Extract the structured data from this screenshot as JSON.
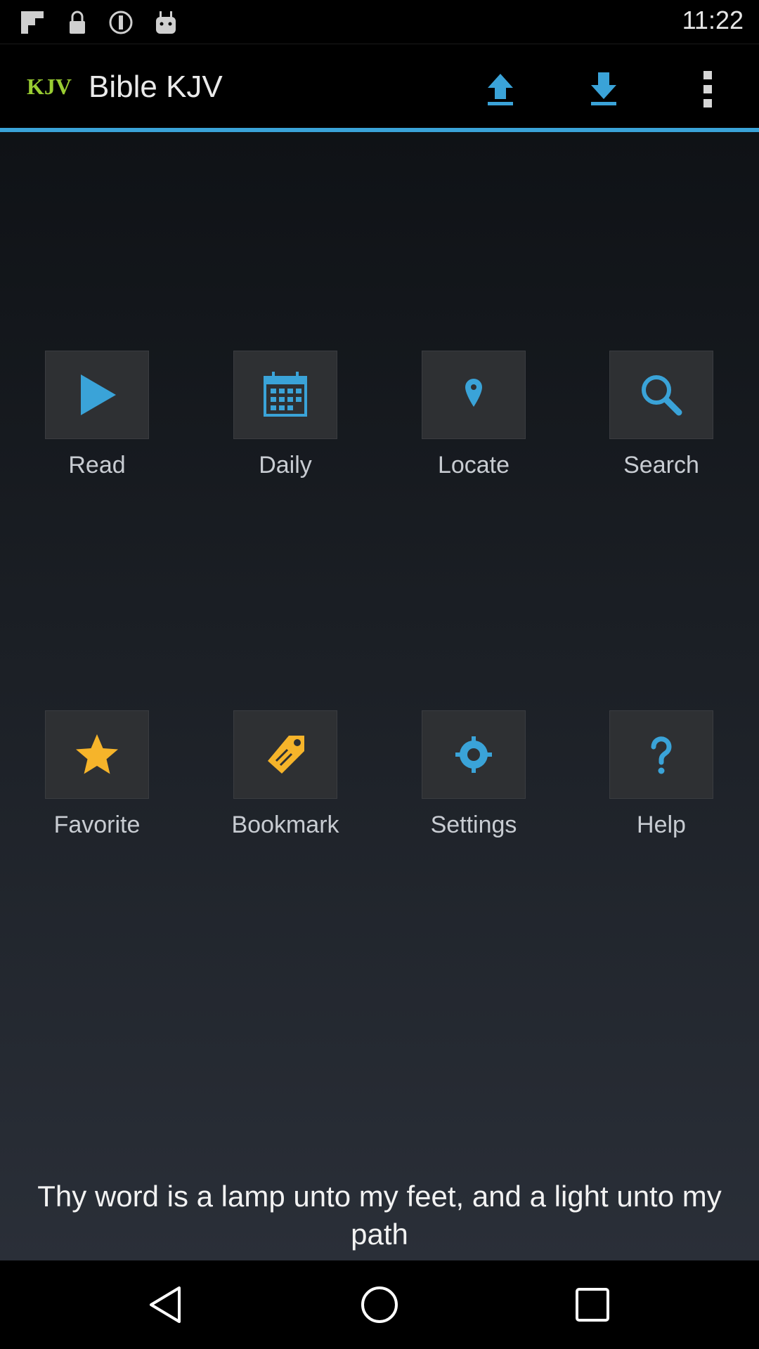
{
  "status_bar": {
    "time": "11:22",
    "icons": [
      "flipboard-icon",
      "lock-icon",
      "data-saver-icon",
      "android-icon"
    ]
  },
  "action_bar": {
    "logo": "KJV",
    "title": "Bible KJV",
    "upload_icon": "upload-icon",
    "download_icon": "download-icon",
    "menu_icon": "more-vert-icon"
  },
  "tiles": [
    {
      "label": "Read",
      "icon": "play-icon"
    },
    {
      "label": "Daily",
      "icon": "calendar-icon"
    },
    {
      "label": "Locate",
      "icon": "location-pin-icon"
    },
    {
      "label": "Search",
      "icon": "search-icon"
    },
    {
      "label": "Favorite",
      "icon": "star-icon"
    },
    {
      "label": "Bookmark",
      "icon": "tag-icon"
    },
    {
      "label": "Settings",
      "icon": "gear-icon"
    },
    {
      "label": "Help",
      "icon": "help-icon"
    }
  ],
  "verse": "Thy word is a lamp unto my feet, and a light unto my path",
  "nav_bar": {
    "icons": [
      "back-icon",
      "home-icon",
      "recents-icon"
    ]
  },
  "colors": {
    "accent": "#3aa3d8",
    "star": "#f6b42a",
    "logo": "#9acd32",
    "tile_bg": "#2e3033"
  }
}
